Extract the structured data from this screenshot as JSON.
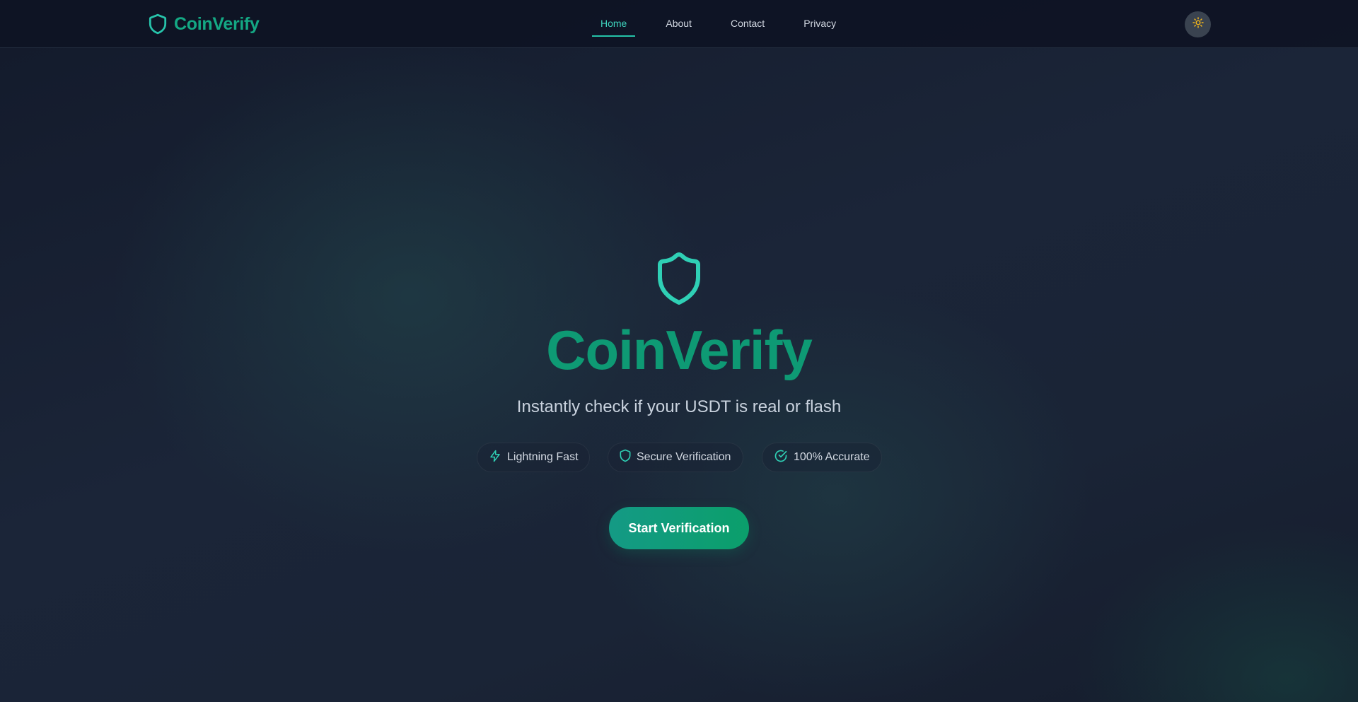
{
  "brand": {
    "name": "CoinVerify",
    "icon": "shield-icon",
    "color": "#14a884"
  },
  "nav": {
    "links": [
      {
        "label": "Home",
        "active": true
      },
      {
        "label": "About",
        "active": false
      },
      {
        "label": "Contact",
        "active": false
      },
      {
        "label": "Privacy",
        "active": false
      }
    ],
    "active_color": "#3fd3bd"
  },
  "theme_toggle": {
    "icon": "sun-icon",
    "icon_color": "#f2b51c"
  },
  "hero": {
    "icon": "shield-icon",
    "title": "CoinVerify",
    "subtitle": "Instantly check if your USDT is real or flash",
    "title_color": "#0e9a74",
    "accent_color": "#2fd0b5"
  },
  "features": [
    {
      "icon": "lightning-icon",
      "label": "Lightning Fast"
    },
    {
      "icon": "shield-icon",
      "label": "Secure Verification"
    },
    {
      "icon": "check-circle-icon",
      "label": "100% Accurate"
    }
  ],
  "cta": {
    "label": "Start Verification"
  }
}
